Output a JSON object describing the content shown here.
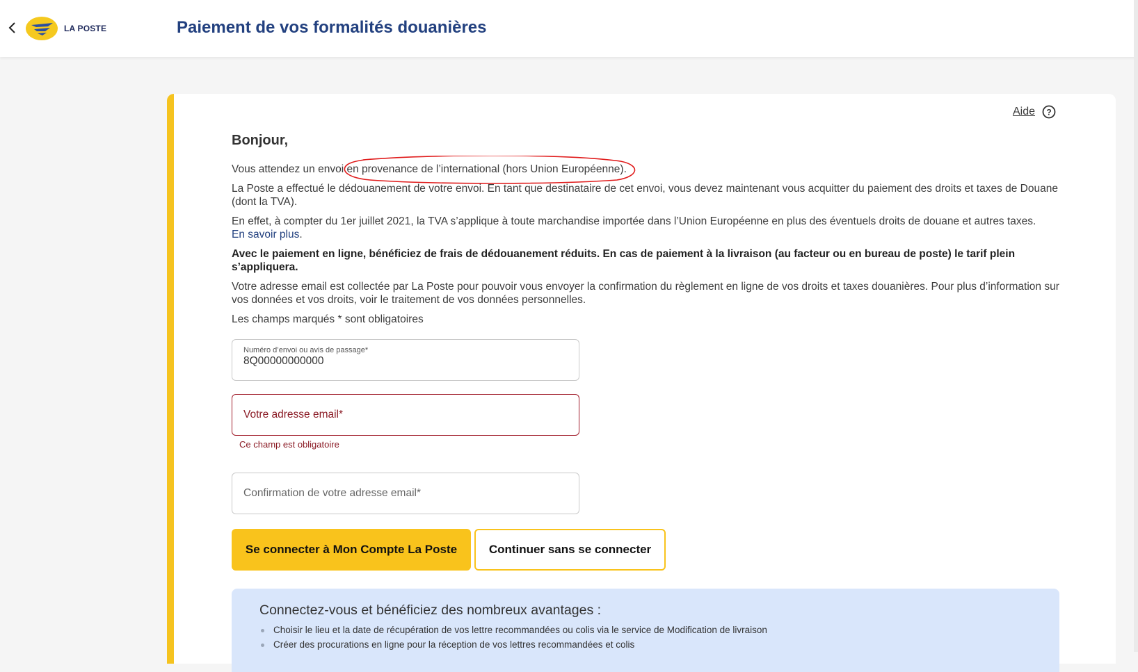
{
  "header": {
    "logo_text": "LA POSTE",
    "title": "Paiement de vos formalités douanières"
  },
  "help": {
    "label": "Aide"
  },
  "content": {
    "greeting": "Bonjour,",
    "p1_pre": "Vous attendez un envoi ",
    "p1_highlight": "en provenance de l’international (hors Union Européenne).",
    "p2": "La Poste a effectué le dédouanement de votre envoi. En tant que destinataire de cet envoi, vous devez maintenant vous acquitter du paiement des droits et taxes de Douane (dont la TVA).",
    "p3": "En effet, à compter du 1er juillet 2021, la TVA s’applique à toute marchandise importée dans l’Union Européenne en plus des éventuels droits de douane et autres taxes.",
    "p3_link": "En savoir plus",
    "p3_link_suffix": ".",
    "p4": "Avec le paiement en ligne, bénéficiez de frais de dédouanement réduits. En cas de paiement à la livraison (au facteur ou en bureau de poste) le tarif plein s’appliquera.",
    "p5": "Votre adresse email est collectée par La Poste pour pouvoir vous envoyer la confirmation du règlement en ligne de vos droits et taxes douanières. Pour plus d’information sur vos données et vos droits, voir le traitement de vos données personnelles.",
    "p6": "Les champs marqués * sont obligatoires"
  },
  "form": {
    "tracking": {
      "label": "Numéro d’envoi ou avis de passage*",
      "value": "8Q00000000000"
    },
    "email": {
      "placeholder": "Votre adresse email*",
      "error": "Ce champ est obligatoire"
    },
    "email_confirm": {
      "placeholder": "Confirmation de votre adresse email*"
    }
  },
  "buttons": {
    "login": "Se connecter à Mon Compte La Poste",
    "continue": "Continuer sans se connecter"
  },
  "benefits": {
    "title": "Connectez-vous et bénéficiez des nombreux avantages :",
    "items": [
      "Choisir le lieu et la date de récupération de vos lettre recommandées ou colis via le service de Modification de livraison",
      "Créer des procurations en ligne pour la réception de vos lettres recommandées et colis"
    ]
  },
  "colors": {
    "accent_yellow": "#f9c31c",
    "title_blue": "#22407f",
    "error_red": "#a11d2b",
    "benefits_bg": "#d9e6fb",
    "annotation_red": "#e01b1b"
  },
  "icons": {
    "back": "chevron-left-icon",
    "logo": "la-poste-logo",
    "help": "question-circle-icon"
  }
}
